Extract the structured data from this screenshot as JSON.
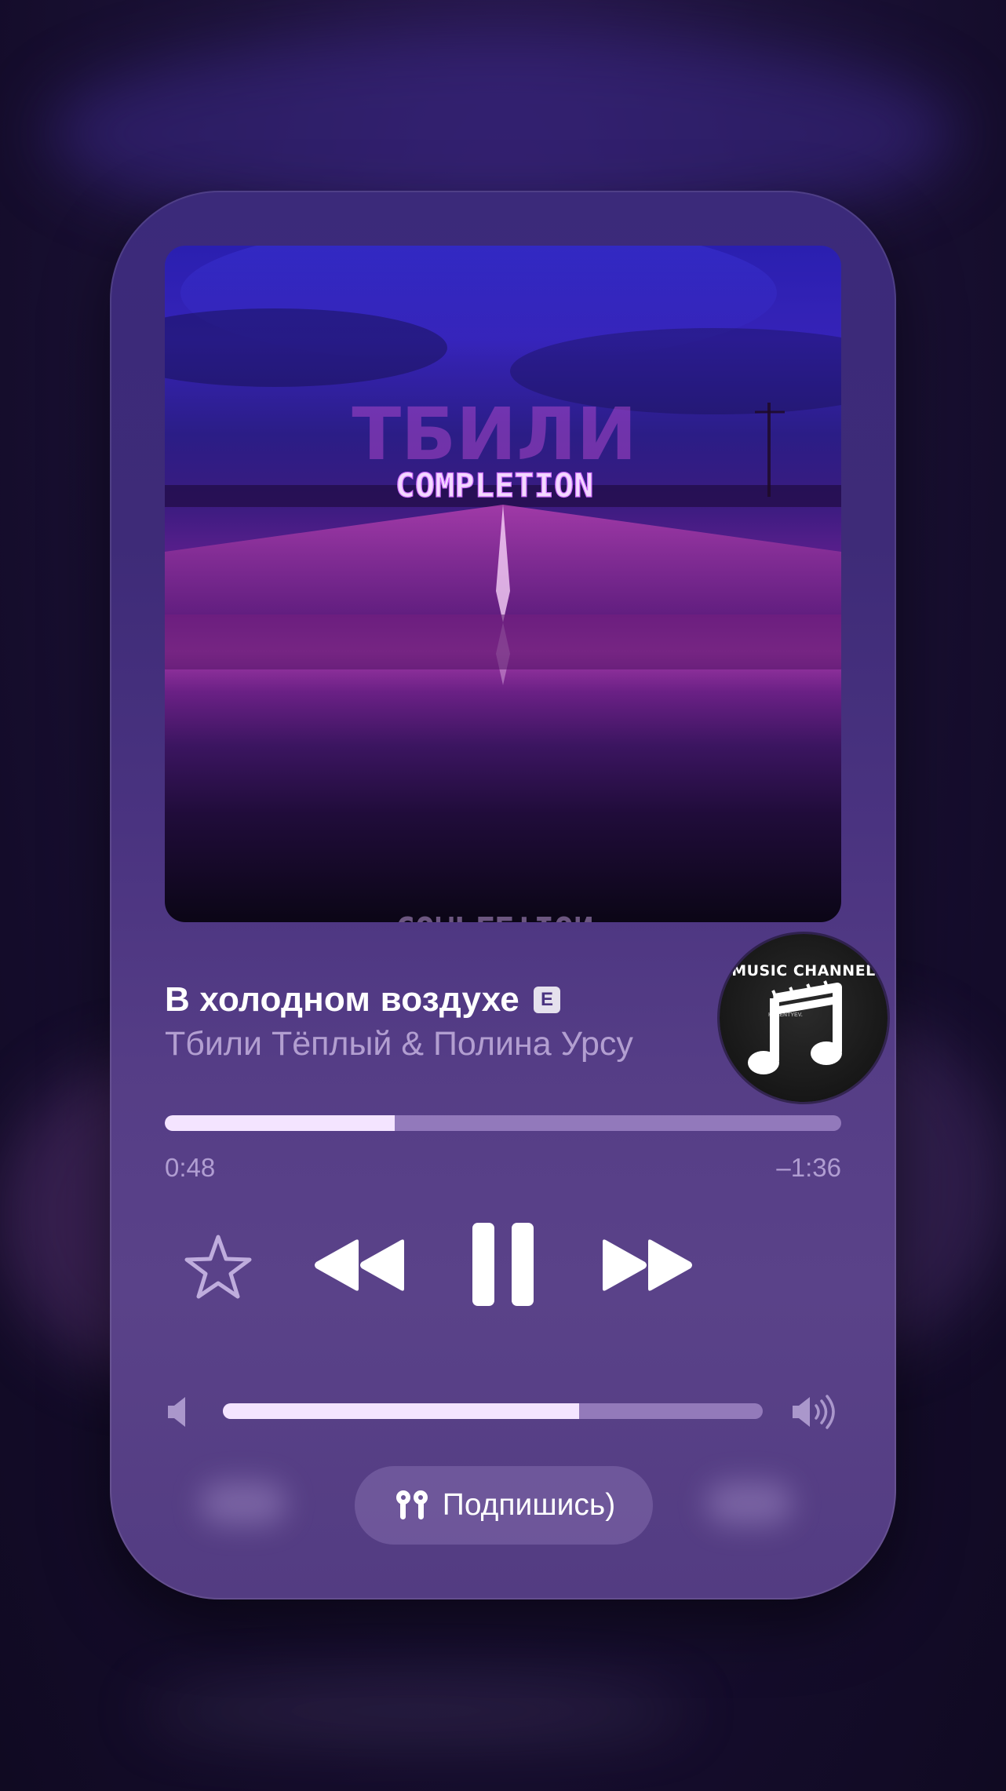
{
  "album": {
    "art_title": "ТБИЛИ",
    "art_subtitle": "COMPLETION"
  },
  "track": {
    "title": "В холодном воздухе",
    "explicit_badge": "E",
    "artist": "Тбили Тёплый & Полина Урсу"
  },
  "channel": {
    "name": "MUSIC CHANNEL",
    "sub": "KALENTYEV.",
    "icon": "music-note-icon"
  },
  "progress": {
    "elapsed": "0:48",
    "remaining": "–1:36",
    "fraction": 0.34
  },
  "controls": {
    "favorite_icon": "star-icon",
    "previous_icon": "rewind-icon",
    "play_pause_icon": "pause-icon",
    "next_icon": "fast-forward-icon"
  },
  "volume": {
    "level": 0.66,
    "min_icon": "speaker-low-icon",
    "max_icon": "speaker-high-icon"
  },
  "output": {
    "icon": "airpods-icon",
    "label": "Подпишись)"
  },
  "colors": {
    "accent": "#f4e4ff",
    "card": "#4a3380",
    "background": "#1c1238"
  }
}
